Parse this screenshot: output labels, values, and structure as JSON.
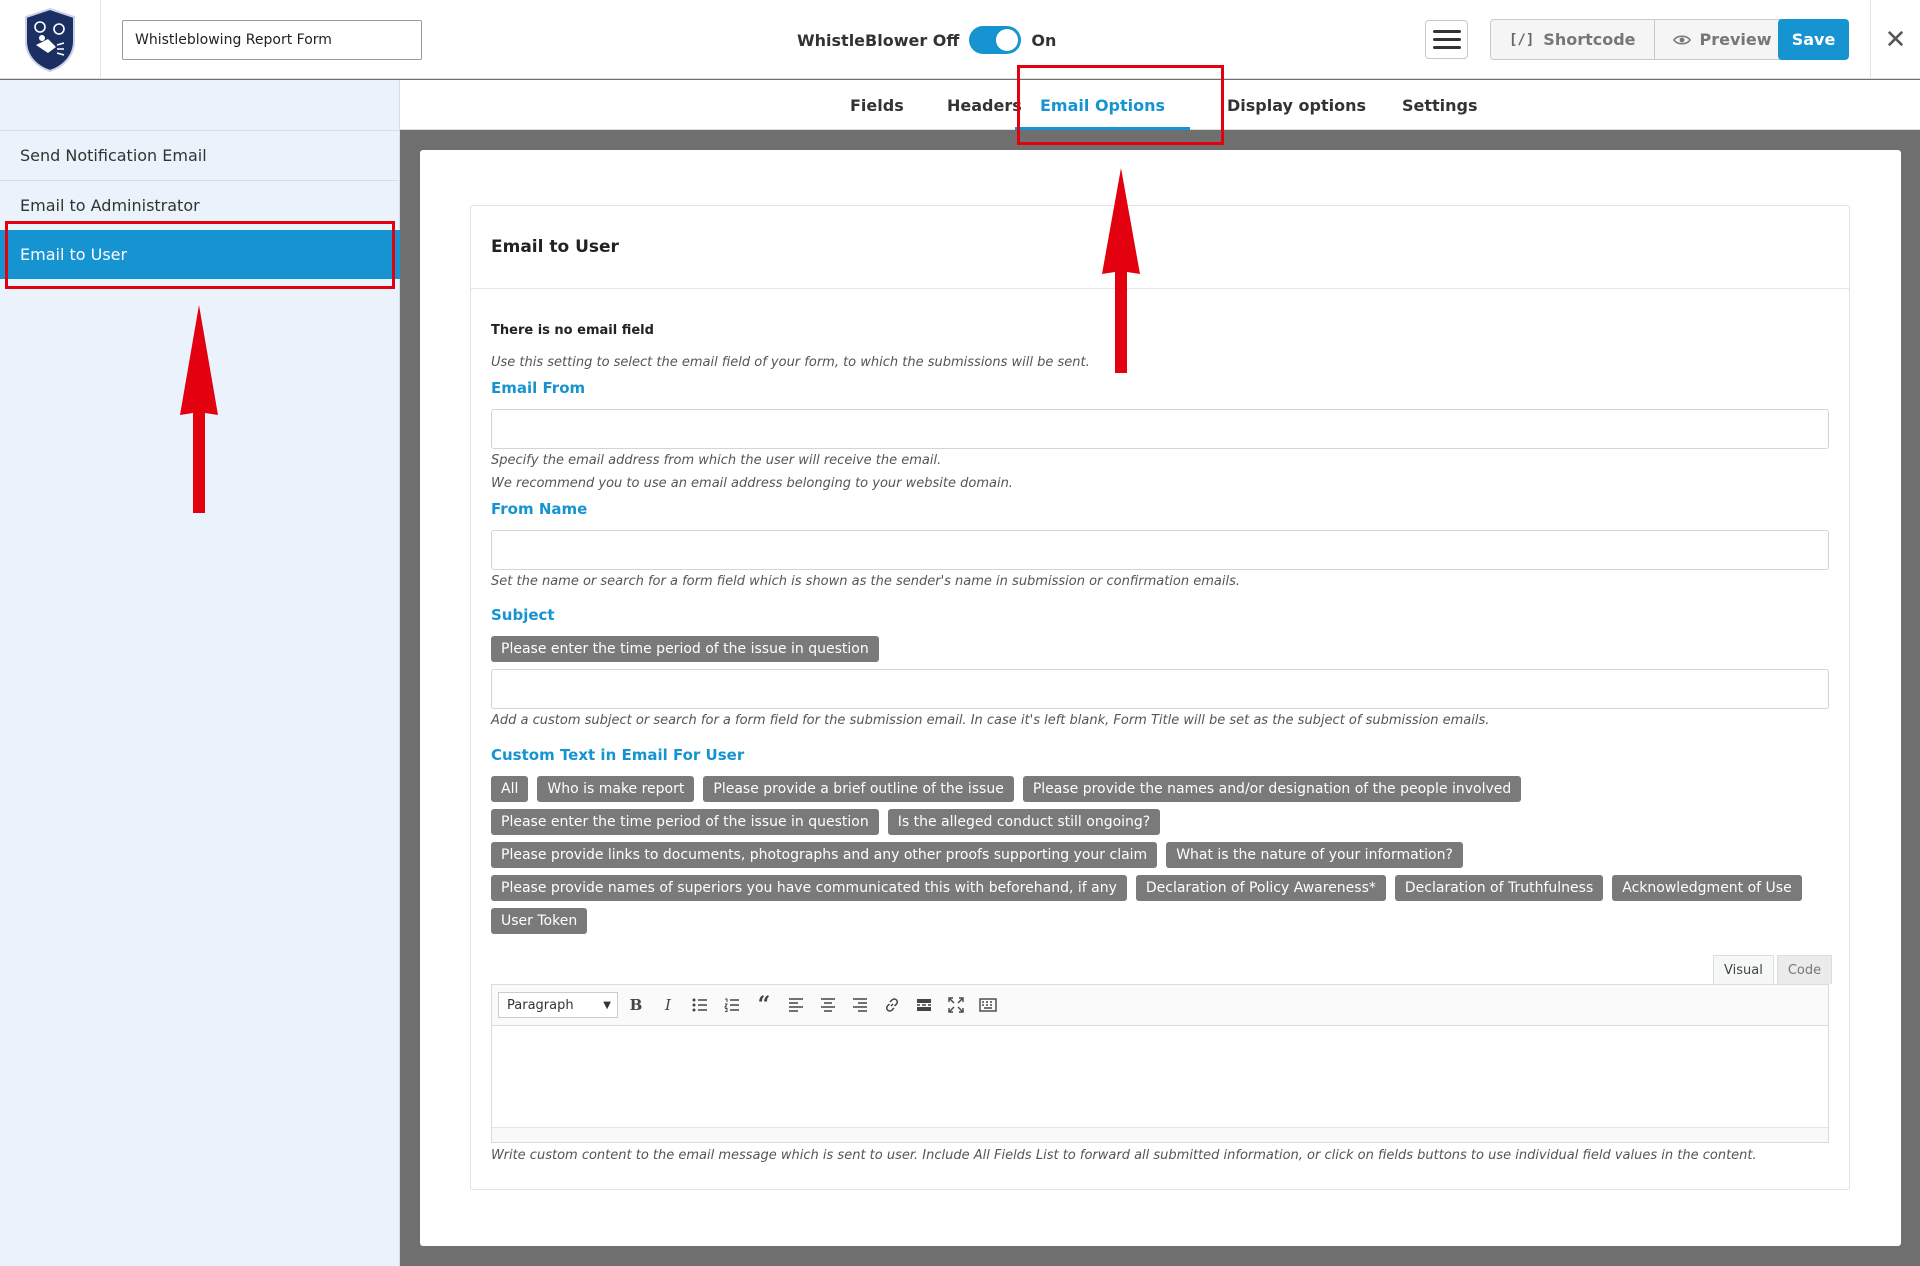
{
  "header": {
    "form_title_value": "Whistleblowing Report Form",
    "toggle_off_label": "WhistleBlower Off",
    "toggle_on_label": "On",
    "toggle_state": "on",
    "shortcode_icon": "[/]",
    "shortcode_label": "Shortcode",
    "preview_label": "Preview",
    "save_label": "Save",
    "close_glyph": "✕"
  },
  "sidebar": {
    "items": [
      {
        "label": "Send Notification Email",
        "active": false
      },
      {
        "label": "Email to Administrator",
        "active": false
      },
      {
        "label": "Email to User",
        "active": true
      }
    ]
  },
  "tabs": [
    {
      "label": "Fields",
      "active": false
    },
    {
      "label": "Headers",
      "active": false
    },
    {
      "label": "Email Options",
      "active": true
    },
    {
      "label": "Display options",
      "active": false
    },
    {
      "label": "Settings",
      "active": false
    }
  ],
  "panel": {
    "title": "Email to User",
    "no_email_note": "There is no email field",
    "no_email_help": "Use this setting to select the email field of your form, to which the submissions will be sent.",
    "email_from": {
      "label": "Email From",
      "value": "",
      "help1": "Specify the email address from which the user will receive the email.",
      "help2": "We recommend you to use an email address belonging to your website domain."
    },
    "from_name": {
      "label": "From Name",
      "value": "",
      "help": "Set the name or search for a form field which is shown as the sender's name in submission or confirmation emails."
    },
    "subject": {
      "label": "Subject",
      "chip": "Please enter the time period of the issue in question",
      "value": "",
      "help": "Add a custom subject or search for a form field for the submission email. In case it's left blank, Form Title will be set as the subject of submission emails."
    },
    "custom_text": {
      "label": "Custom Text in Email For User",
      "chip_rows": [
        [
          "All",
          "Who is make report",
          "Please provide a brief outline of the issue",
          "Please provide the names and/or designation of the people involved"
        ],
        [
          "Please enter the time period of the issue in question",
          "Is the alleged conduct still ongoing?"
        ],
        [
          "Please provide links to documents, photographs and any other proofs supporting your claim",
          "What is the nature of your information?"
        ],
        [
          "Please provide names of superiors you have communicated this with beforehand, if any",
          "Declaration of Policy Awareness*",
          "Declaration of Truthfulness",
          "Acknowledgment of Use"
        ],
        [
          "User Token"
        ]
      ],
      "editor_tab_visual": "Visual",
      "editor_tab_code": "Code",
      "paragraph_select": "Paragraph",
      "toolbar_icons": [
        "bold-icon",
        "italic-icon",
        "bullet-list-icon",
        "numbered-list-icon",
        "blockquote-icon",
        "align-left-icon",
        "align-center-icon",
        "align-right-icon",
        "link-icon",
        "read-more-icon",
        "fullscreen-icon",
        "keyboard-icon"
      ],
      "editor_value": "",
      "help": "Write custom content to the email message which is sent to user. Include All Fields List to forward all submitted information, or click on fields buttons to use individual field values in the content."
    }
  },
  "colors": {
    "accent": "#1594d1",
    "sidebar_bg": "#eaf2fb",
    "chip_bg": "#7a7a7a",
    "annotation_red": "#e3000f",
    "backdrop": "#6f6f6f"
  }
}
